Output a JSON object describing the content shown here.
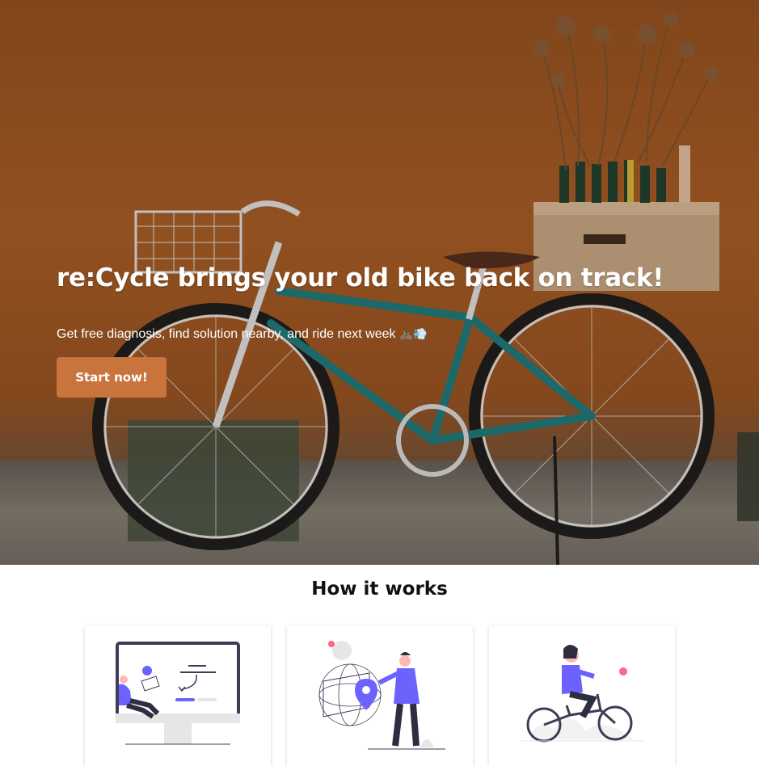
{
  "hero": {
    "title": "re:Cycle brings your old bike back on track!",
    "subtitle": "Get free diagnosis, find solution nearby, and ride next week",
    "subtitle_emoji": "🚲💨",
    "cta_label": "Start now!",
    "background_color": "#8a4a1f",
    "cta_color": "#c9733d"
  },
  "how_it_works": {
    "title": "How it works",
    "steps": [
      {
        "illustration": "diagnosis-screen-illustration"
      },
      {
        "illustration": "location-map-illustration"
      },
      {
        "illustration": "cyclist-riding-illustration"
      }
    ],
    "accent_color": "#6c63ff"
  }
}
